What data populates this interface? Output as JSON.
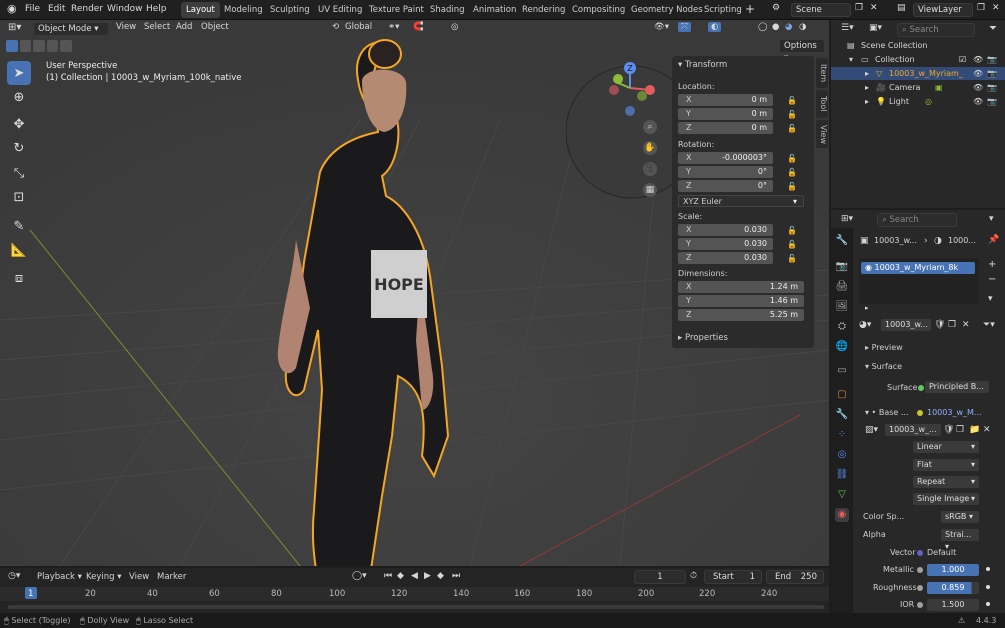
{
  "top_menu": {
    "items": [
      "File",
      "Edit",
      "Render",
      "Window",
      "Help"
    ]
  },
  "workspaces": [
    {
      "label": "Layout",
      "active": true
    },
    {
      "label": "Modeling"
    },
    {
      "label": "Sculpting"
    },
    {
      "label": "UV Editing"
    },
    {
      "label": "Texture Paint"
    },
    {
      "label": "Shading"
    },
    {
      "label": "Animation"
    },
    {
      "label": "Rendering"
    },
    {
      "label": "Compositing"
    },
    {
      "label": "Geometry Nodes"
    },
    {
      "label": "Scripting"
    }
  ],
  "scene": {
    "name": "Scene",
    "view_layer": "ViewLayer"
  },
  "viewport_header": {
    "mode": "Object Mode",
    "menus": [
      "View",
      "Select",
      "Add",
      "Object"
    ],
    "orientation": "Global",
    "options_label": "Options"
  },
  "viewport_info": {
    "perspective": "User Perspective",
    "collection_line": "(1) Collection | 10003_w_Myriam_100k_native"
  },
  "model_text": "HOPE",
  "navigation_gizmo": {
    "axis_z": "Z"
  },
  "n_panel": {
    "title": "Transform",
    "location_label": "Location:",
    "location": [
      {
        "axis": "X",
        "value": "0 m"
      },
      {
        "axis": "Y",
        "value": "0 m"
      },
      {
        "axis": "Z",
        "value": "0 m"
      }
    ],
    "rotation_label": "Rotation:",
    "rotation": [
      {
        "axis": "X",
        "value": "-0.000003°"
      },
      {
        "axis": "Y",
        "value": "0°"
      },
      {
        "axis": "Z",
        "value": "0°"
      }
    ],
    "rotation_mode": "XYZ Euler",
    "scale_label": "Scale:",
    "scale": [
      {
        "axis": "X",
        "value": "0.030"
      },
      {
        "axis": "Y",
        "value": "0.030"
      },
      {
        "axis": "Z",
        "value": "0.030"
      }
    ],
    "dimensions_label": "Dimensions:",
    "dimensions": [
      {
        "axis": "X",
        "value": "1.24 m"
      },
      {
        "axis": "Y",
        "value": "1.46 m"
      },
      {
        "axis": "Z",
        "value": "5.25 m"
      }
    ],
    "properties_label": "Properties",
    "tabs": [
      "Item",
      "Tool",
      "View"
    ]
  },
  "outliner": {
    "search_placeholder": "Search",
    "rows": [
      {
        "label": "Scene Collection"
      },
      {
        "label": "Collection"
      },
      {
        "label": "10003_w_Myriam_",
        "selected": true
      },
      {
        "label": "Camera"
      },
      {
        "label": "Light"
      }
    ]
  },
  "properties": {
    "search_placeholder": "Search",
    "breadcrumb_object": "10003_w...",
    "breadcrumb_material": "1000...",
    "material_slot": "10003_w_Myriam_8k",
    "material_name": "10003_w...",
    "preview_label": "Preview",
    "surface_label": "Surface",
    "surface_field_label": "Surface",
    "surface_value": "Principled B...",
    "base_label": "Base ...",
    "base_value": "10003_w_M...",
    "image_name": "10003_w_...",
    "interpolation": "Linear",
    "projection": "Flat",
    "extension": "Repeat",
    "source": "Single Image",
    "color_space_label": "Color Sp...",
    "color_space": "sRGB",
    "alpha_label": "Alpha",
    "alpha_value": "Strai...",
    "vector_label": "Vector",
    "vector_value": "Default",
    "metallic_label": "Metallic",
    "metallic_value": "1.000",
    "roughness_label": "Roughness",
    "roughness_value": "0.859",
    "ior_label": "IOR",
    "ior_value": "1.500"
  },
  "timeline": {
    "menus": [
      "Playback",
      "Keying",
      "View",
      "Marker"
    ],
    "current_frame": "1",
    "start_label": "Start",
    "start": "1",
    "end_label": "End",
    "end": "250",
    "ticks": [
      "1",
      "20",
      "40",
      "60",
      "80",
      "100",
      "120",
      "140",
      "160",
      "180",
      "200",
      "220",
      "240"
    ]
  },
  "statusbar": {
    "items": [
      "Select (Toggle)",
      "Dolly View",
      "Lasso Select"
    ],
    "version": "4.4.3"
  },
  "colors": {
    "accent": "#4772b3",
    "selection_outline": "#f5a623",
    "header": "#202020"
  }
}
